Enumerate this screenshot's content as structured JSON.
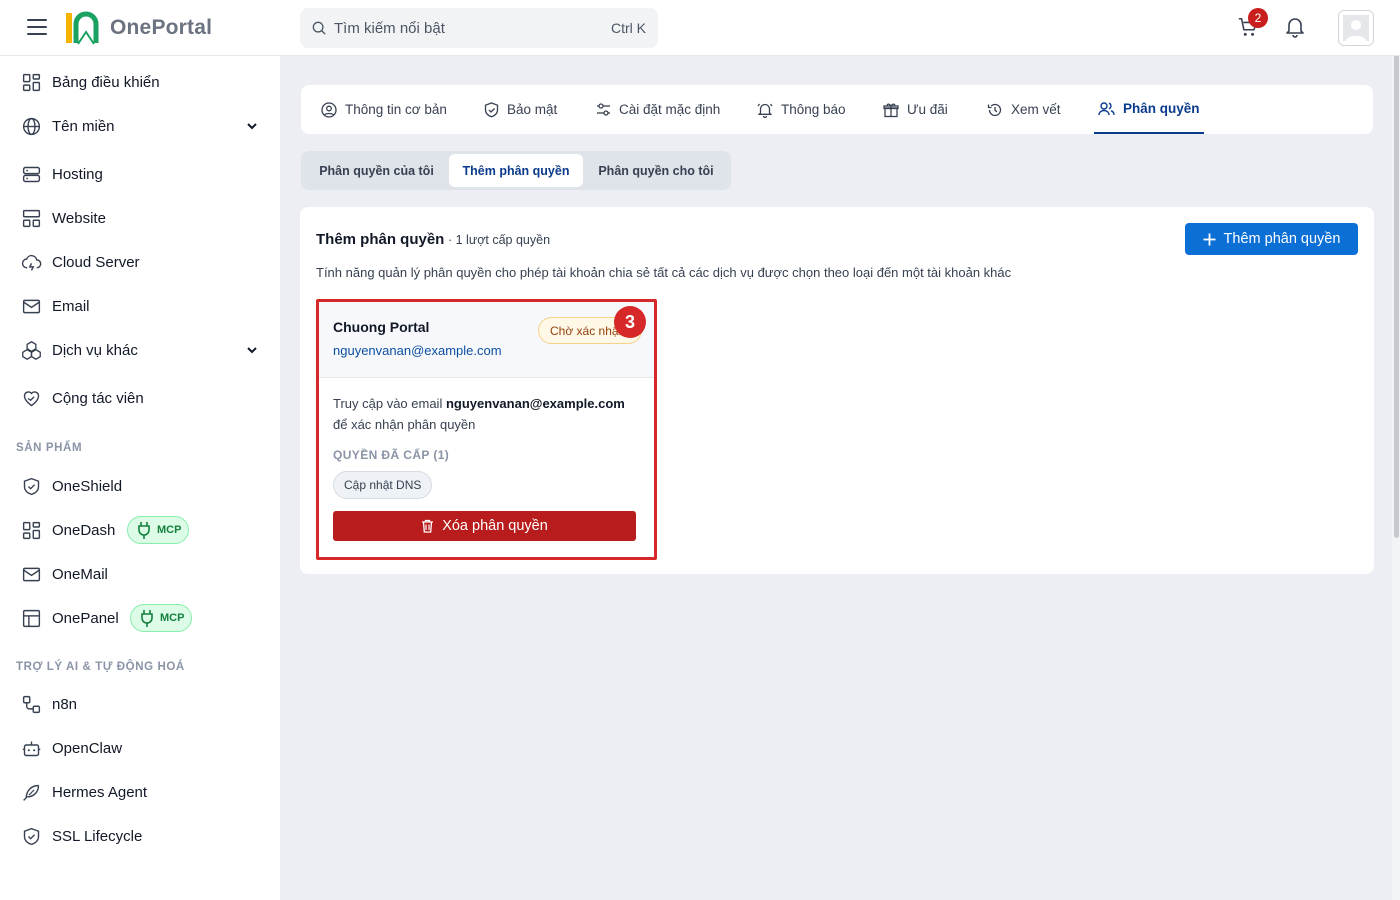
{
  "app": {
    "name": "OnePortal"
  },
  "search": {
    "placeholder": "Tìm kiếm nổi bật",
    "shortcut": "Ctrl K"
  },
  "header": {
    "cart_count": "2"
  },
  "sidebar": {
    "items": [
      {
        "label": "Bảng điều khiển"
      },
      {
        "label": "Tên miền"
      },
      {
        "label": "Hosting"
      },
      {
        "label": "Website"
      },
      {
        "label": "Cloud Server"
      },
      {
        "label": "Email"
      },
      {
        "label": "Dịch vụ khác"
      },
      {
        "label": "Cộng tác viên"
      }
    ],
    "products_title": "SẢN PHẨM",
    "products": [
      {
        "label": "OneShield"
      },
      {
        "label": "OneDash",
        "badge": "MCP"
      },
      {
        "label": "OneMail"
      },
      {
        "label": "OnePanel",
        "badge": "MCP"
      }
    ],
    "ai_title": "TRỢ LÝ AI & TỰ ĐỘNG HOÁ",
    "ai": [
      {
        "label": "n8n"
      },
      {
        "label": "OpenClaw"
      },
      {
        "label": "Hermes Agent"
      },
      {
        "label": "SSL Lifecycle"
      }
    ]
  },
  "tabs": [
    {
      "label": "Thông tin cơ bản"
    },
    {
      "label": "Bảo mật"
    },
    {
      "label": "Cài đặt mặc định"
    },
    {
      "label": "Thông báo"
    },
    {
      "label": "Ưu đãi"
    },
    {
      "label": "Xem vết"
    },
    {
      "label": "Phân quyền"
    }
  ],
  "subtabs": [
    {
      "label": "Phân quyền của tôi"
    },
    {
      "label": "Thêm phân quyền"
    },
    {
      "label": "Phân quyền cho tôi"
    }
  ],
  "main": {
    "title": "Thêm phân quyền",
    "count": "· 1 lượt cấp quyền",
    "description": "Tính năng quản lý phân quyền cho phép tài khoản chia sẻ tất cả các dịch vụ được chọn theo loại đến một tài khoản khác",
    "add_button": "Thêm phân quyền",
    "permission": {
      "name": "Chuong Portal",
      "email": "nguyenvanan@example.com",
      "status": "Chờ xác nhận",
      "step": "3",
      "message_prefix": "Truy cập vào email",
      "message_email": "nguyenvanan@example.com",
      "message_suffix": "để xác nhận phân quyền",
      "granted_title": "QUYỀN ĐÃ CẤP (1)",
      "granted_items": [
        "Cập nhật DNS"
      ],
      "delete_button": "Xóa phân quyền"
    }
  },
  "colors": {
    "primary": "#0b6fd6",
    "danger": "#b91c1c",
    "active_tab": "#0b3b8c",
    "mcp_green": "#15803d"
  }
}
